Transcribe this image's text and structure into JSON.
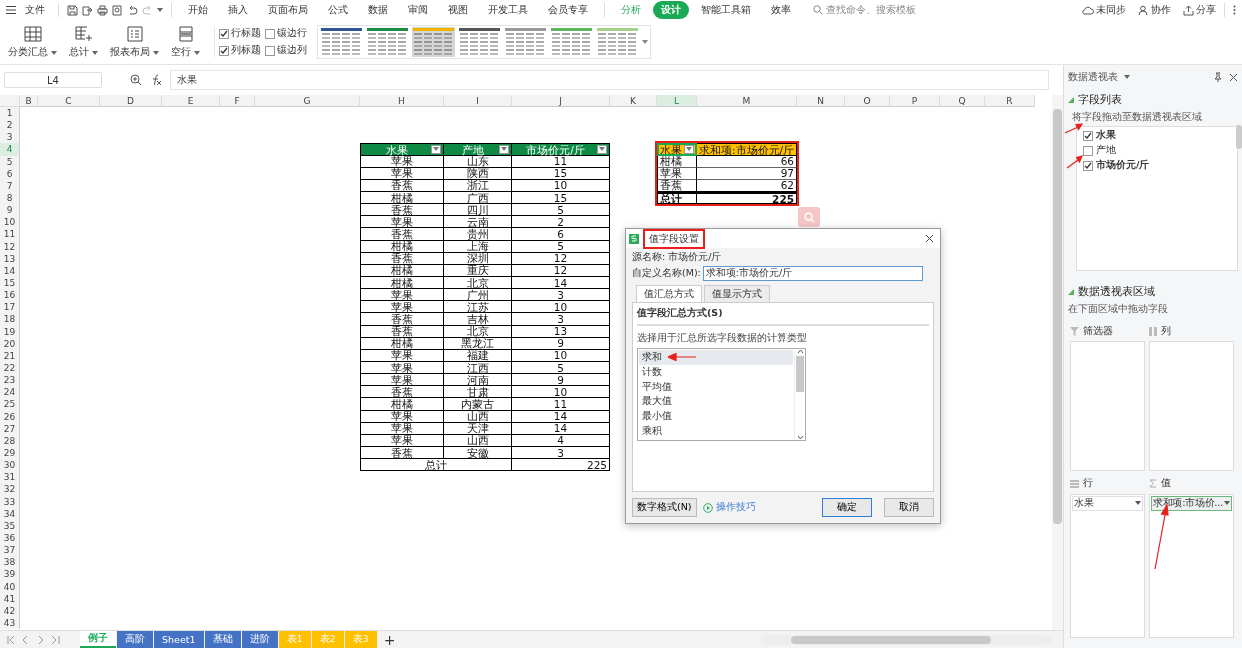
{
  "menu_bar": {
    "file": "文件",
    "tabs": [
      {
        "label": "开始",
        "selected": false,
        "contextual": false
      },
      {
        "label": "插入",
        "selected": false,
        "contextual": false
      },
      {
        "label": "页面布局",
        "selected": false,
        "contextual": false
      },
      {
        "label": "公式",
        "selected": false,
        "contextual": false
      },
      {
        "label": "数据",
        "selected": false,
        "contextual": false
      },
      {
        "label": "审阅",
        "selected": false,
        "contextual": false
      },
      {
        "label": "视图",
        "selected": false,
        "contextual": false
      },
      {
        "label": "开发工具",
        "selected": false,
        "contextual": false
      },
      {
        "label": "会员专享",
        "selected": false,
        "contextual": false
      },
      {
        "label": "分析",
        "selected": false,
        "contextual": true
      },
      {
        "label": "设计",
        "selected": true,
        "contextual": true
      },
      {
        "label": "智能工具箱",
        "selected": false,
        "contextual": false
      },
      {
        "label": "效率",
        "selected": false,
        "contextual": false
      }
    ],
    "search": {
      "placeholder": "查找命令、搜索模板"
    },
    "actions": [
      {
        "kind": "sync",
        "label": "未同步"
      },
      {
        "kind": "collab",
        "label": "协作"
      },
      {
        "kind": "share",
        "label": "分享"
      }
    ]
  },
  "ribbon": {
    "buttons": [
      {
        "kind": "subtotal",
        "label": "分类汇总"
      },
      {
        "kind": "total",
        "label": "总计"
      },
      {
        "kind": "layout",
        "label": "报表布局"
      },
      {
        "kind": "blank",
        "label": "空行"
      }
    ],
    "options": [
      {
        "label": "行标题",
        "checked": true
      },
      {
        "label": "镶边行",
        "checked": false
      },
      {
        "label": "列标题",
        "checked": true
      },
      {
        "label": "镶边列",
        "checked": false
      }
    ],
    "styles": [
      {
        "color": "#2f5597",
        "selected": false
      },
      {
        "color": "#1e8c45",
        "selected": false
      },
      {
        "color": "#f0b400",
        "selected": true
      },
      {
        "color": "#555555",
        "selected": false
      },
      {
        "color": "#999999",
        "selected": false
      },
      {
        "color": "#5cb85c",
        "selected": false
      },
      {
        "color": "#a8d08d",
        "selected": false
      }
    ]
  },
  "formula_bar": {
    "cell": "L4",
    "formula": "水果"
  },
  "sheet": {
    "columns": [
      {
        "label": "B",
        "selected": false
      },
      {
        "label": "C",
        "selected": false
      },
      {
        "label": "D",
        "selected": false
      },
      {
        "label": "E",
        "selected": false
      },
      {
        "label": "F",
        "selected": false
      },
      {
        "label": "G",
        "selected": false
      },
      {
        "label": "H",
        "selected": false
      },
      {
        "label": "I",
        "selected": false
      },
      {
        "label": "J",
        "selected": false
      },
      {
        "label": "K",
        "selected": false
      },
      {
        "label": "L",
        "selected": true
      },
      {
        "label": "M",
        "selected": false
      },
      {
        "label": "N",
        "selected": false
      },
      {
        "label": "O",
        "selected": false
      },
      {
        "label": "P",
        "selected": false
      },
      {
        "label": "Q",
        "selected": false
      },
      {
        "label": "R",
        "selected": false
      }
    ],
    "rows": [
      {
        "label": "1",
        "selected": false
      },
      {
        "label": "2",
        "selected": false
      },
      {
        "label": "3",
        "selected": false
      },
      {
        "label": "4",
        "selected": true
      },
      {
        "label": "5",
        "selected": false
      },
      {
        "label": "6",
        "selected": false
      },
      {
        "label": "7",
        "selected": false
      },
      {
        "label": "8",
        "selected": false
      },
      {
        "label": "9",
        "selected": false
      },
      {
        "label": "10",
        "selected": false
      },
      {
        "label": "11",
        "selected": false
      },
      {
        "label": "12",
        "selected": false
      },
      {
        "label": "13",
        "selected": false
      },
      {
        "label": "14",
        "selected": false
      },
      {
        "label": "15",
        "selected": false
      },
      {
        "label": "16",
        "selected": false
      },
      {
        "label": "17",
        "selected": false
      },
      {
        "label": "18",
        "selected": false
      },
      {
        "label": "19",
        "selected": false
      },
      {
        "label": "20",
        "selected": false
      },
      {
        "label": "21",
        "selected": false
      },
      {
        "label": "22",
        "selected": false
      },
      {
        "label": "23",
        "selected": false
      },
      {
        "label": "24",
        "selected": false
      },
      {
        "label": "25",
        "selected": false
      },
      {
        "label": "26",
        "selected": false
      },
      {
        "label": "27",
        "selected": false
      },
      {
        "label": "28",
        "selected": false
      },
      {
        "label": "29",
        "selected": false
      },
      {
        "label": "30",
        "selected": false
      },
      {
        "label": "31",
        "selected": false
      },
      {
        "label": "32",
        "selected": false
      },
      {
        "label": "33",
        "selected": false
      },
      {
        "label": "34",
        "selected": false
      },
      {
        "label": "35",
        "selected": false
      },
      {
        "label": "36",
        "selected": false
      },
      {
        "label": "37",
        "selected": false
      },
      {
        "label": "38",
        "selected": false
      },
      {
        "label": "39",
        "selected": false
      },
      {
        "label": "40",
        "selected": false
      },
      {
        "label": "41",
        "selected": false
      },
      {
        "label": "42",
        "selected": false
      },
      {
        "label": "43",
        "selected": false
      }
    ]
  },
  "data_table": {
    "columns": [
      "水果",
      "产地",
      "市场价元/斤"
    ],
    "rows": [
      [
        "苹果",
        "山东",
        "11"
      ],
      [
        "苹果",
        "陕西",
        "15"
      ],
      [
        "香蕉",
        "浙江",
        "10"
      ],
      [
        "柑橘",
        "广西",
        "15"
      ],
      [
        "香蕉",
        "四川",
        "5"
      ],
      [
        "苹果",
        "云南",
        "2"
      ],
      [
        "香蕉",
        "贵州",
        "6"
      ],
      [
        "柑橘",
        "上海",
        "5"
      ],
      [
        "香蕉",
        "深圳",
        "12"
      ],
      [
        "柑橘",
        "重庆",
        "12"
      ],
      [
        "柑橘",
        "北京",
        "14"
      ],
      [
        "苹果",
        "广州",
        "3"
      ],
      [
        "苹果",
        "江苏",
        "10"
      ],
      [
        "香蕉",
        "吉林",
        "3"
      ],
      [
        "香蕉",
        "北京",
        "13"
      ],
      [
        "柑橘",
        "黑龙江",
        "9"
      ],
      [
        "苹果",
        "福建",
        "10"
      ],
      [
        "苹果",
        "江西",
        "5"
      ],
      [
        "苹果",
        "河南",
        "9"
      ],
      [
        "香蕉",
        "甘肃",
        "10"
      ],
      [
        "柑橘",
        "内蒙古",
        "11"
      ],
      [
        "苹果",
        "山西",
        "14"
      ],
      [
        "苹果",
        "天津",
        "14"
      ],
      [
        "苹果",
        "山西",
        "4"
      ],
      [
        "香蕉",
        "安徽",
        "3"
      ]
    ],
    "total": {
      "label": "总计",
      "value": "225"
    }
  },
  "pivot_table": {
    "columns": [
      "水果",
      "求和项:市场价元/斤"
    ],
    "rows": [
      [
        "柑橘",
        "66"
      ],
      [
        "苹果",
        "97"
      ],
      [
        "香蕉",
        "62"
      ]
    ],
    "total": {
      "label": "总计",
      "value": "225"
    }
  },
  "dialog": {
    "title": "值字段设置",
    "source": "源名称: 市场价元/斤",
    "custom_name": {
      "label": "自定义名称(M):",
      "value": "求和项:市场价元/斤"
    },
    "tabs": [
      {
        "label": "值汇总方式",
        "selected": true
      },
      {
        "label": "值显示方式",
        "selected": false
      }
    ],
    "section_title": "值字段汇总方式(S)",
    "instruction": "选择用于汇总所选字段数据的计算类型",
    "functions": [
      {
        "label": "求和",
        "selected": true
      },
      {
        "label": "计数",
        "selected": false
      },
      {
        "label": "平均值",
        "selected": false
      },
      {
        "label": "最大值",
        "selected": false
      },
      {
        "label": "最小值",
        "selected": false
      },
      {
        "label": "乘积",
        "selected": false
      }
    ],
    "number_format": "数字格式(N)",
    "tips": "操作技巧",
    "ok": "确定",
    "cancel": "取消"
  },
  "side_panel": {
    "title": "数据透视表",
    "field_list": {
      "title": "字段列表",
      "hint": "将字段拖动至数据透视表区域",
      "fields": [
        {
          "label": "水果",
          "checked": true
        },
        {
          "label": "产地",
          "checked": false
        },
        {
          "label": "市场价元/斤",
          "checked": true
        }
      ]
    },
    "areas": {
      "title": "数据透视表区域",
      "hint": "在下面区域中拖动字段",
      "zones": [
        {
          "kind": "filter",
          "label": "筛选器"
        },
        {
          "kind": "column",
          "label": "列"
        },
        {
          "kind": "row",
          "label": "行",
          "item": {
            "label": "水果",
            "selected": false
          }
        },
        {
          "kind": "value",
          "label": "值",
          "item": {
            "label": "求和项:市场价...",
            "selected": true
          }
        }
      ]
    }
  },
  "sheet_tabs": [
    {
      "label": "例子",
      "selected": true
    },
    {
      "label": "高阶",
      "selected": false,
      "color": "#4472c4"
    },
    {
      "label": "Sheet1",
      "selected": false,
      "color": "#4472c4"
    },
    {
      "label": "基础",
      "selected": false,
      "color": "#4472c4"
    },
    {
      "label": "进阶",
      "selected": false,
      "color": "#4472c4"
    },
    {
      "label": "表1",
      "selected": false,
      "color": "#ffc000"
    },
    {
      "label": "表2",
      "selected": false,
      "color": "#ffc000"
    },
    {
      "label": "表3",
      "selected": false,
      "color": "#ffc000"
    }
  ],
  "add_sheet": "+"
}
